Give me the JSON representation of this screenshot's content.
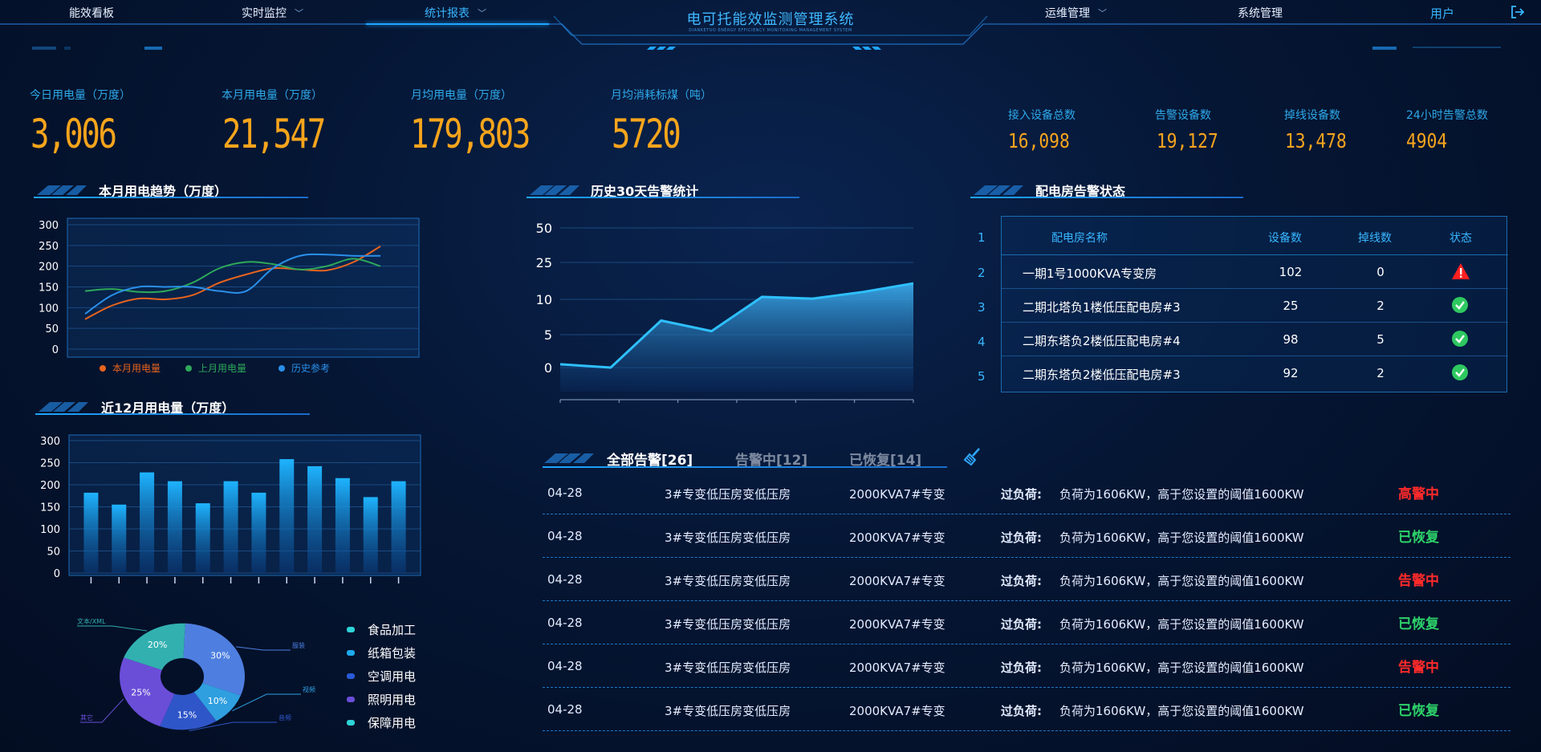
{
  "nav": {
    "items": [
      {
        "label": "能效看板",
        "has_chevron": false
      },
      {
        "label": "实时监控",
        "has_chevron": true
      },
      {
        "label": "统计报表",
        "has_chevron": true,
        "active": true
      },
      {
        "label": "运维管理",
        "has_chevron": true
      },
      {
        "label": "系统管理",
        "has_chevron": false
      }
    ],
    "title": "电可托能效监测管理系统",
    "subtitle": "DIANKETUO ENERGY EFFICIENCY MONITORING MANAGEMENT SYSTEM",
    "user": "用户"
  },
  "kpis": [
    {
      "label": "今日用电量（万度）",
      "value": "3,006"
    },
    {
      "label": "本月用电量（万度）",
      "value": "21,547"
    },
    {
      "label": "月均用电量（万度）",
      "value": "179,803"
    },
    {
      "label": "月均消耗标煤（吨）",
      "value": "5720"
    }
  ],
  "device_stats": [
    {
      "label": "接入设备总数",
      "value": "16,098"
    },
    {
      "label": "告警设备数",
      "value": "19,127"
    },
    {
      "label": "掉线设备数",
      "value": "13,478"
    },
    {
      "label": "24小时告警总数",
      "value": "4904"
    }
  ],
  "sections": {
    "trend": "本月用电趋势（万度）",
    "history": "历史30天告警统计",
    "rooms": "配电房告警状态",
    "yearly": "近12月用电量（万度）"
  },
  "chart_data": [
    {
      "type": "line",
      "title": "本月用电趋势（万度）",
      "yticks": [
        0,
        50,
        100,
        150,
        200,
        250,
        300
      ],
      "ylim": [
        0,
        300
      ],
      "grid": true,
      "legend": "bottom",
      "series": [
        {
          "name": "本月用电量",
          "color": "#e8641e",
          "values": [
            72,
            105,
            122,
            120,
            130,
            160,
            180,
            195,
            192,
            190,
            210,
            248
          ]
        },
        {
          "name": "上月用电量",
          "color": "#2ea85a",
          "values": [
            140,
            145,
            138,
            140,
            160,
            195,
            210,
            205,
            192,
            200,
            218,
            200
          ]
        },
        {
          "name": "历史参考",
          "color": "#2a8fe8",
          "values": [
            85,
            130,
            150,
            150,
            150,
            140,
            140,
            195,
            225,
            228,
            225,
            225
          ]
        }
      ]
    },
    {
      "type": "area",
      "title": "历史30天告警统计",
      "yticks": [
        "0",
        "5",
        "10",
        "25",
        "50"
      ],
      "values": [
        0.5,
        0,
        7,
        5.5,
        11,
        10.3,
        13,
        16.5
      ],
      "value_ticks": [
        0,
        5,
        10,
        25,
        50
      ]
    },
    {
      "type": "bar",
      "title": "近12月用电量（万度）",
      "yticks": [
        0,
        50,
        100,
        150,
        200,
        250,
        300
      ],
      "ylim": [
        0,
        300
      ],
      "values": [
        182,
        155,
        228,
        208,
        158,
        208,
        182,
        258,
        242,
        215,
        172,
        208
      ]
    },
    {
      "type": "pie",
      "slices": [
        {
          "label": "30%",
          "tag": "服装",
          "value": 30,
          "color": "#4e7fe0"
        },
        {
          "label": "10%",
          "tag": "视频",
          "value": 10,
          "color": "#2f9fe0"
        },
        {
          "label": "15%",
          "tag": "音频",
          "value": 15,
          "color": "#2f56c8"
        },
        {
          "label": "25%",
          "tag": "其它",
          "value": 25,
          "color": "#6a4ed8"
        },
        {
          "label": "20%",
          "tag": "文本/XML",
          "value": 20,
          "color": "#32b0b0"
        }
      ],
      "legend": [
        {
          "name": "食品加工",
          "color": "#2ed3d8"
        },
        {
          "name": "纸箱包装",
          "color": "#1eaaf0"
        },
        {
          "name": "空调用电",
          "color": "#2a5ad8"
        },
        {
          "name": "照明用电",
          "color": "#6a4ed8"
        },
        {
          "name": "保障用电",
          "color": "#2ed3d8"
        }
      ]
    }
  ],
  "rooms": {
    "headers": [
      "配电房名称",
      "设备数",
      "掉线数",
      "状态"
    ],
    "index": [
      "1",
      "2",
      "3",
      "4",
      "5"
    ],
    "rows": [
      {
        "name": "一期1号1000KVA专变房",
        "devices": "102",
        "offline": "0",
        "status": "alarm"
      },
      {
        "name": "二期北塔负1楼低压配电房#3",
        "devices": "25",
        "offline": "2",
        "status": "ok"
      },
      {
        "name": "二期东塔负2楼低压配电房#4",
        "devices": "98",
        "offline": "5",
        "status": "ok"
      },
      {
        "name": "二期东塔负2楼低压配电房#3",
        "devices": "92",
        "offline": "2",
        "status": "ok"
      }
    ]
  },
  "alarms": {
    "tabs": [
      {
        "label": "全部告警[26]",
        "color": "#ffffff"
      },
      {
        "label": "告警中[12]",
        "color": "#7d8aa0"
      },
      {
        "label": "已恢复[14]",
        "color": "#7d8aa0"
      }
    ],
    "rows": [
      {
        "date": "04-28",
        "room": "3#专变低压房变低压房",
        "device": "2000KVA7#专变",
        "type": "过负荷:",
        "desc": "负荷为1606KW，高于您设置的阈值1600KW",
        "status": "高警中",
        "status_color": "#ff2a2a"
      },
      {
        "date": "04-28",
        "room": "3#专变低压房变低压房",
        "device": "2000KVA7#专变",
        "type": "过负荷:",
        "desc": "负荷为1606KW，高于您设置的阈值1600KW",
        "status": "已恢复",
        "status_color": "#2ed36a"
      },
      {
        "date": "04-28",
        "room": "3#专变低压房变低压房",
        "device": "2000KVA7#专变",
        "type": "过负荷:",
        "desc": "负荷为1606KW，高于您设置的阈值1600KW",
        "status": "告警中",
        "status_color": "#ff2a2a"
      },
      {
        "date": "04-28",
        "room": "3#专变低压房变低压房",
        "device": "2000KVA7#专变",
        "type": "过负荷:",
        "desc": "负荷为1606KW，高于您设置的阈值1600KW",
        "status": "已恢复",
        "status_color": "#2ed36a"
      },
      {
        "date": "04-28",
        "room": "3#专变低压房变低压房",
        "device": "2000KVA7#专变",
        "type": "过负荷:",
        "desc": "负荷为1606KW，高于您设置的阈值1600KW",
        "status": "告警中",
        "status_color": "#ff2a2a"
      },
      {
        "date": "04-28",
        "room": "3#专变低压房变低压房",
        "device": "2000KVA7#专变",
        "type": "过负荷:",
        "desc": "负荷为1606KW，高于您设置的阈值1600KW",
        "status": "已恢复",
        "status_color": "#2ed36a"
      }
    ]
  }
}
